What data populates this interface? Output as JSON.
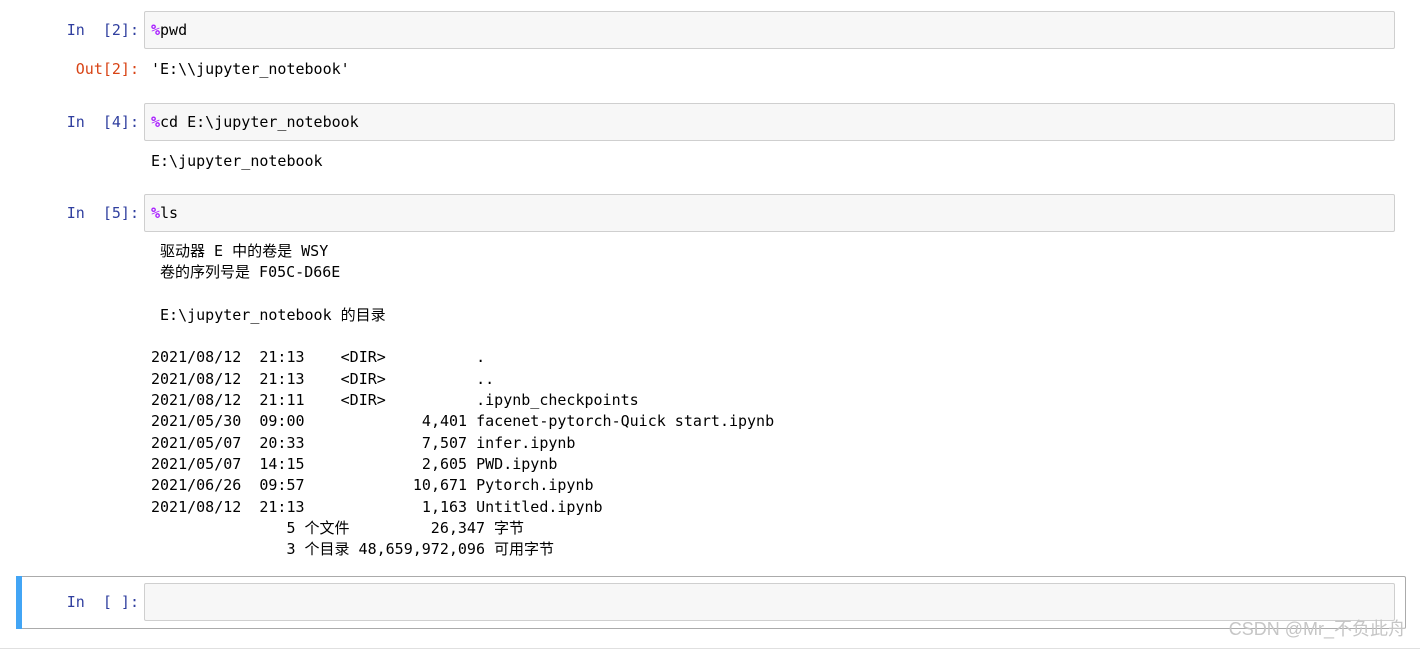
{
  "cells": [
    {
      "prompt": "In  [2]:",
      "magic": "%",
      "code": "pwd",
      "out_prompt": "Out[2]:",
      "output": "'E:\\\\jupyter_notebook'"
    },
    {
      "prompt": "In  [4]:",
      "magic": "%",
      "code": "cd E:\\jupyter_notebook",
      "output": "E:\\jupyter_notebook"
    },
    {
      "prompt": "In  [5]:",
      "magic": "%",
      "code": "ls",
      "output_lines": [
        " 驱动器 E 中的卷是 WSY",
        " 卷的序列号是 F05C-D66E",
        "",
        " E:\\jupyter_notebook 的目录",
        "",
        "2021/08/12  21:13    <DIR>          .",
        "2021/08/12  21:13    <DIR>          ..",
        "2021/08/12  21:11    <DIR>          .ipynb_checkpoints",
        "2021/05/30  09:00             4,401 facenet-pytorch-Quick start.ipynb",
        "2021/05/07  20:33             7,507 infer.ipynb",
        "2021/05/07  14:15             2,605 PWD.ipynb",
        "2021/06/26  09:57            10,671 Pytorch.ipynb",
        "2021/08/12  21:13             1,163 Untitled.ipynb",
        "               5 个文件         26,347 字节",
        "               3 个目录 48,659,972,096 可用字节"
      ]
    },
    {
      "prompt": "In  [ ]:",
      "code": ""
    }
  ],
  "watermark": "CSDN @Mr_不负此舟",
  "colors": {
    "prompt_in": "#303f9f",
    "prompt_out": "#d84315",
    "magic": "#aa22ff",
    "active_bar": "#42a5f5"
  }
}
